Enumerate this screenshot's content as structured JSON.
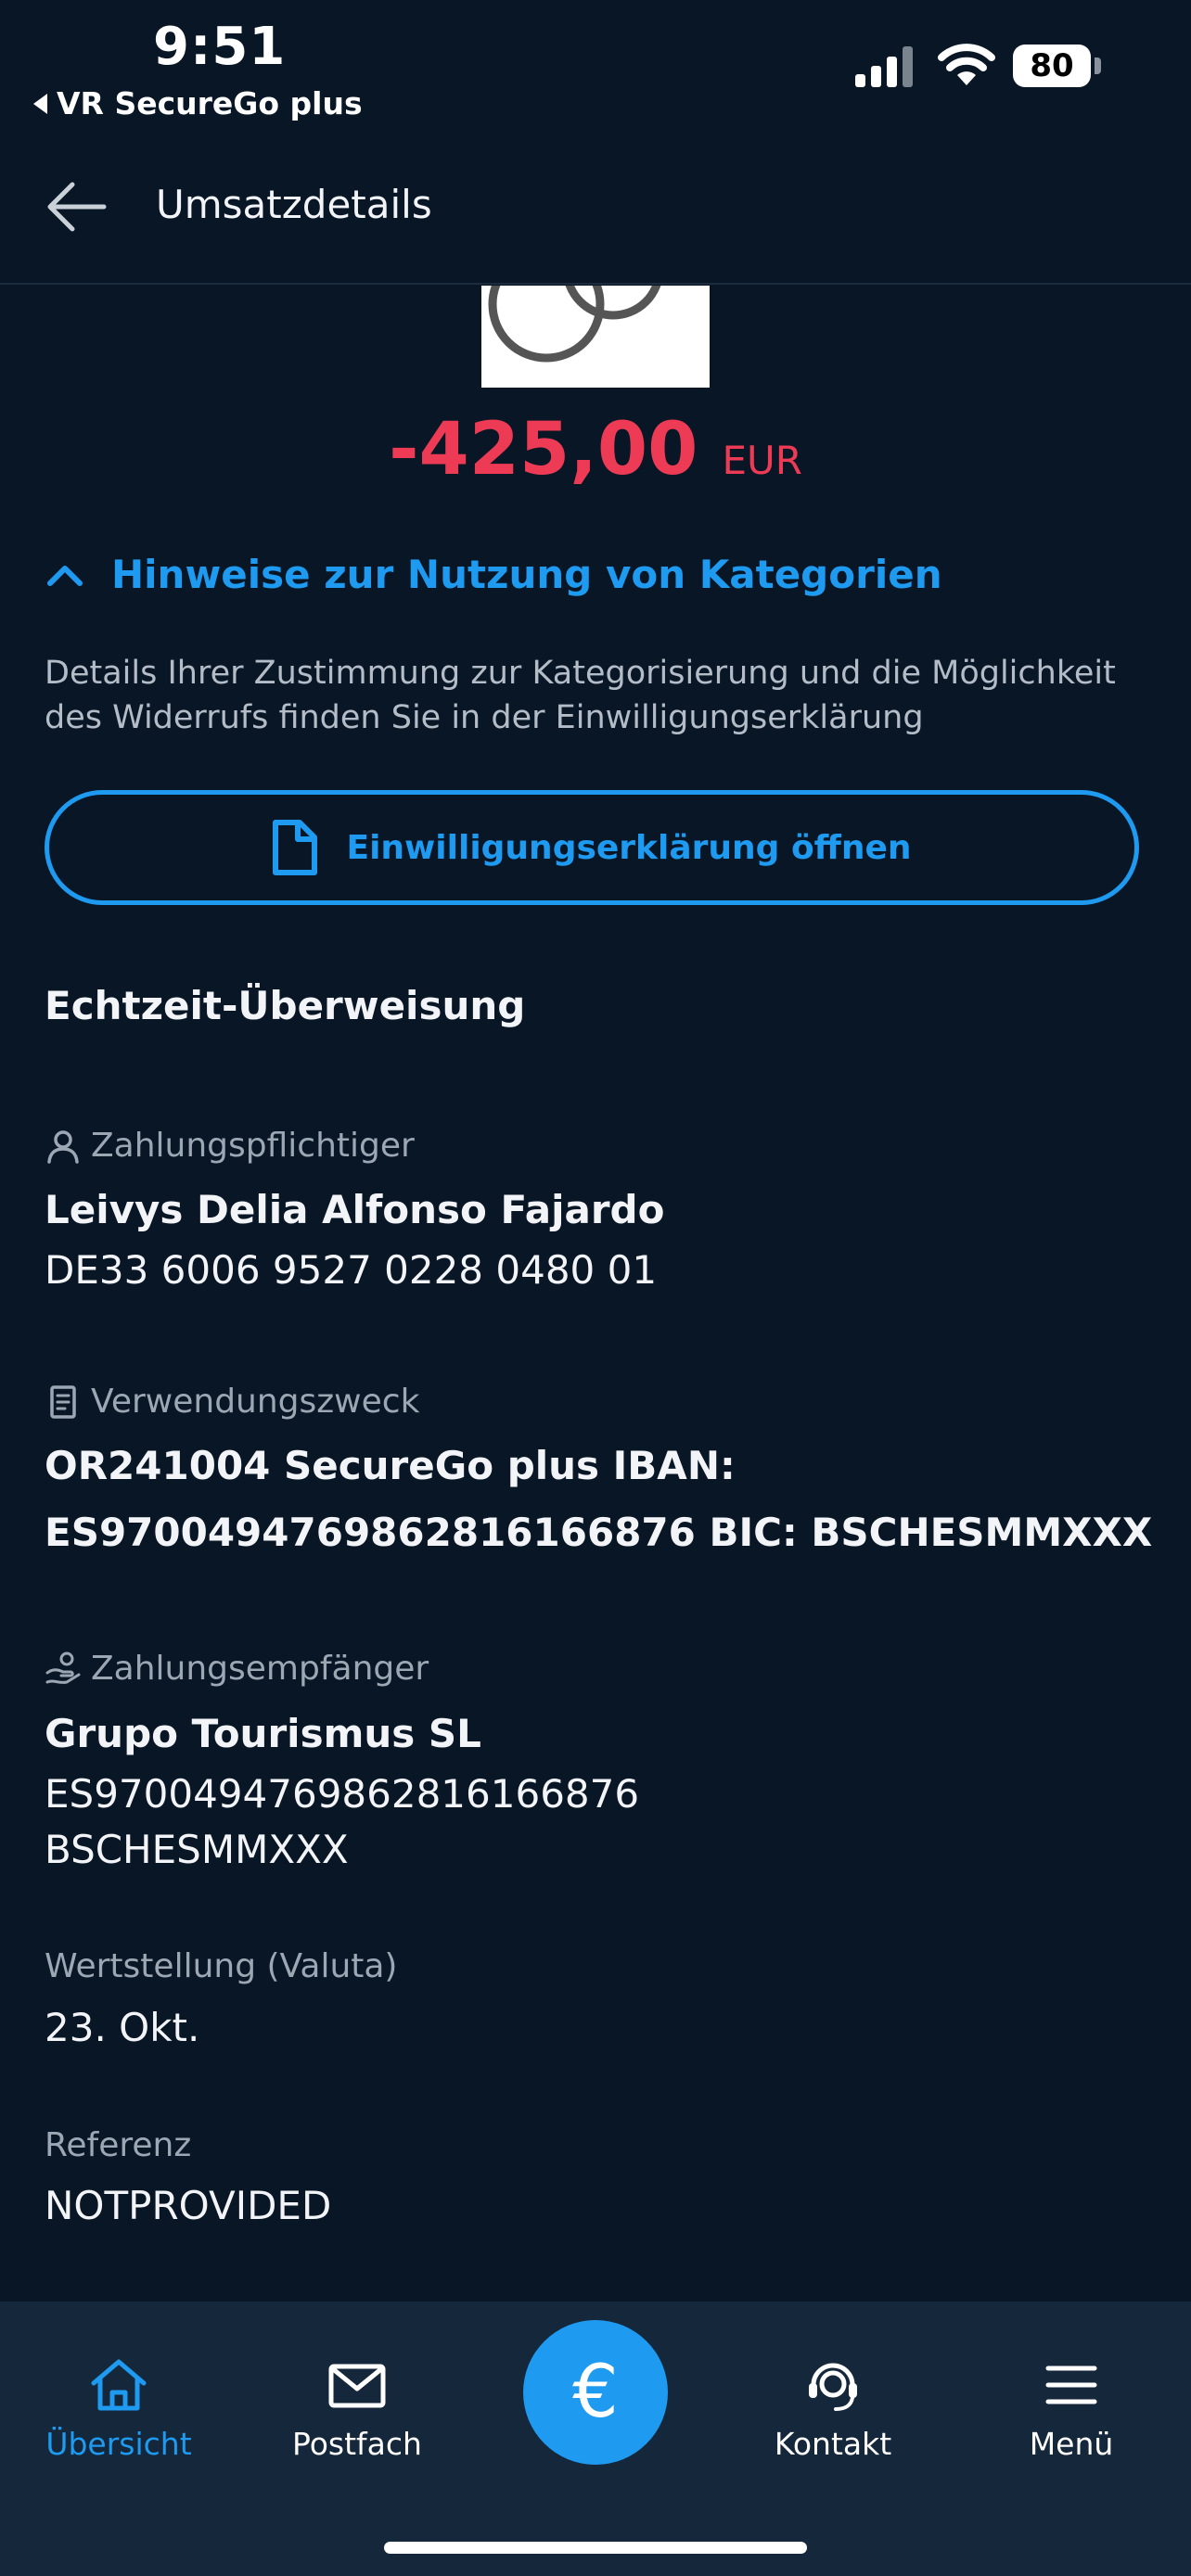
{
  "status_bar": {
    "time": "9:51",
    "back_app": "VR SecureGo plus",
    "battery": "80"
  },
  "header": {
    "title": "Umsatzdetails"
  },
  "amount": {
    "value": "-425,00",
    "currency": "EUR"
  },
  "hint": {
    "title": "Hinweise zur Nutzung von Kategorien",
    "text": "Details Ihrer Zustimmung zur Kategorisierung und die Möglichkeit des Widerrufs finden Sie in der Einwilligungserklärung",
    "button_label": "Einwilligungserklärung öffnen"
  },
  "details": {
    "type": "Echtzeit-Überweisung",
    "payer": {
      "label": "Zahlungspflichtiger",
      "name": "Leivys Delia Alfonso Fajardo",
      "iban": "DE33 6006 9527 0228 0480 01"
    },
    "purpose": {
      "label": "Verwendungszweck",
      "line1": "OR241004 SecureGo plus IBAN:",
      "line2": "ES9700494769862816166876 BIC: BSCHESMMXXX"
    },
    "recipient": {
      "label": "Zahlungsempfänger",
      "name": "Grupo Tourismus SL",
      "iban": "ES9700494769862816166876",
      "bic": "BSCHESMMXXX"
    },
    "value_date": {
      "label": "Wertstellung (Valuta)",
      "value": "23. Okt."
    },
    "reference": {
      "label": "Referenz",
      "value": "NOTPROVIDED"
    }
  },
  "nav": {
    "overview": "Übersicht",
    "mailbox": "Postfach",
    "center_symbol": "€",
    "contact": "Kontakt",
    "menu": "Menü"
  },
  "colors": {
    "background": "#081625",
    "accent": "#1e9af0",
    "negative": "#ee3b55",
    "nav_background": "#14273b"
  }
}
